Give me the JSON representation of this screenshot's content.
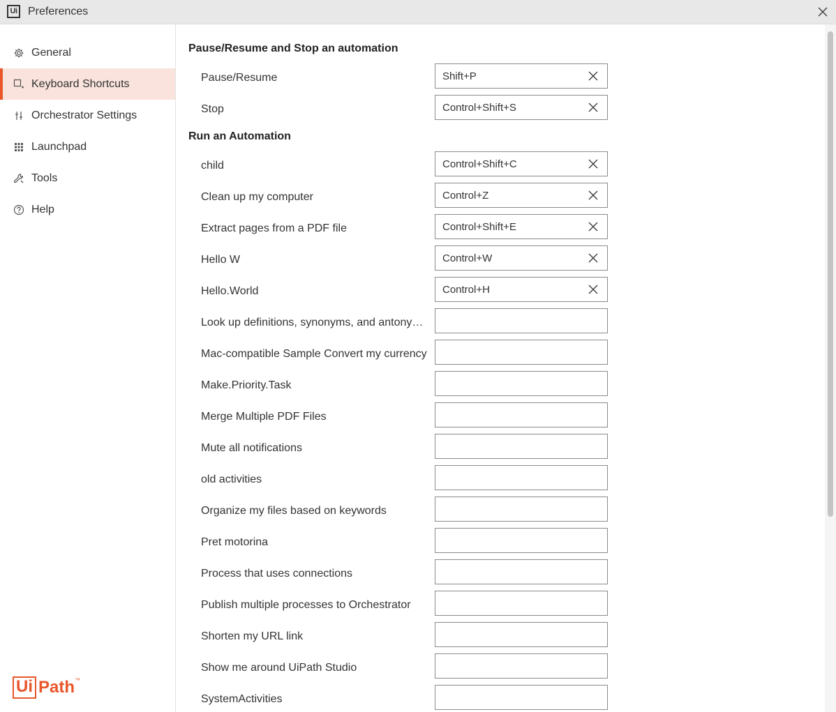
{
  "window": {
    "title": "Preferences",
    "logo": "Ui"
  },
  "sidebar": {
    "items": [
      {
        "label": "General",
        "icon": "gear-icon",
        "active": false
      },
      {
        "label": "Keyboard Shortcuts",
        "icon": "keyboard-shortcut-icon",
        "active": true
      },
      {
        "label": "Orchestrator Settings",
        "icon": "sliders-icon",
        "active": false
      },
      {
        "label": "Launchpad",
        "icon": "grid-icon",
        "active": false
      },
      {
        "label": "Tools",
        "icon": "wrench-icon",
        "active": false
      },
      {
        "label": "Help",
        "icon": "help-circle-icon",
        "active": false
      }
    ],
    "brand": {
      "box": "Ui",
      "text": "Path",
      "tm": "™"
    }
  },
  "colors": {
    "accent": "#e8562a",
    "active_bg": "#f9e3dc"
  },
  "sections": [
    {
      "title": "Pause/Resume and Stop an automation",
      "rows": [
        {
          "label": "Pause/Resume",
          "shortcut": "Shift+P"
        },
        {
          "label": "Stop",
          "shortcut": "Control+Shift+S"
        }
      ]
    },
    {
      "title": "Run an Automation",
      "rows": [
        {
          "label": "child",
          "shortcut": "Control+Shift+C"
        },
        {
          "label": "Clean up my computer",
          "shortcut": "Control+Z"
        },
        {
          "label": "Extract pages from a PDF file",
          "shortcut": "Control+Shift+E"
        },
        {
          "label": "Hello W",
          "shortcut": "Control+W"
        },
        {
          "label": "Hello.World",
          "shortcut": "Control+H"
        },
        {
          "label": "Look up definitions, synonyms, and antony…",
          "shortcut": ""
        },
        {
          "label": "Mac-compatible Sample Convert my currency",
          "shortcut": ""
        },
        {
          "label": "Make.Priority.Task",
          "shortcut": ""
        },
        {
          "label": "Merge Multiple PDF Files",
          "shortcut": ""
        },
        {
          "label": "Mute all notifications",
          "shortcut": ""
        },
        {
          "label": "old activities",
          "shortcut": ""
        },
        {
          "label": "Organize my files based on keywords",
          "shortcut": ""
        },
        {
          "label": "Pret motorina",
          "shortcut": ""
        },
        {
          "label": "Process that uses connections",
          "shortcut": ""
        },
        {
          "label": "Publish multiple processes to Orchestrator",
          "shortcut": ""
        },
        {
          "label": "Shorten my URL link",
          "shortcut": ""
        },
        {
          "label": "Show me around UiPath Studio",
          "shortcut": ""
        },
        {
          "label": "SystemActivities",
          "shortcut": ""
        }
      ]
    }
  ]
}
